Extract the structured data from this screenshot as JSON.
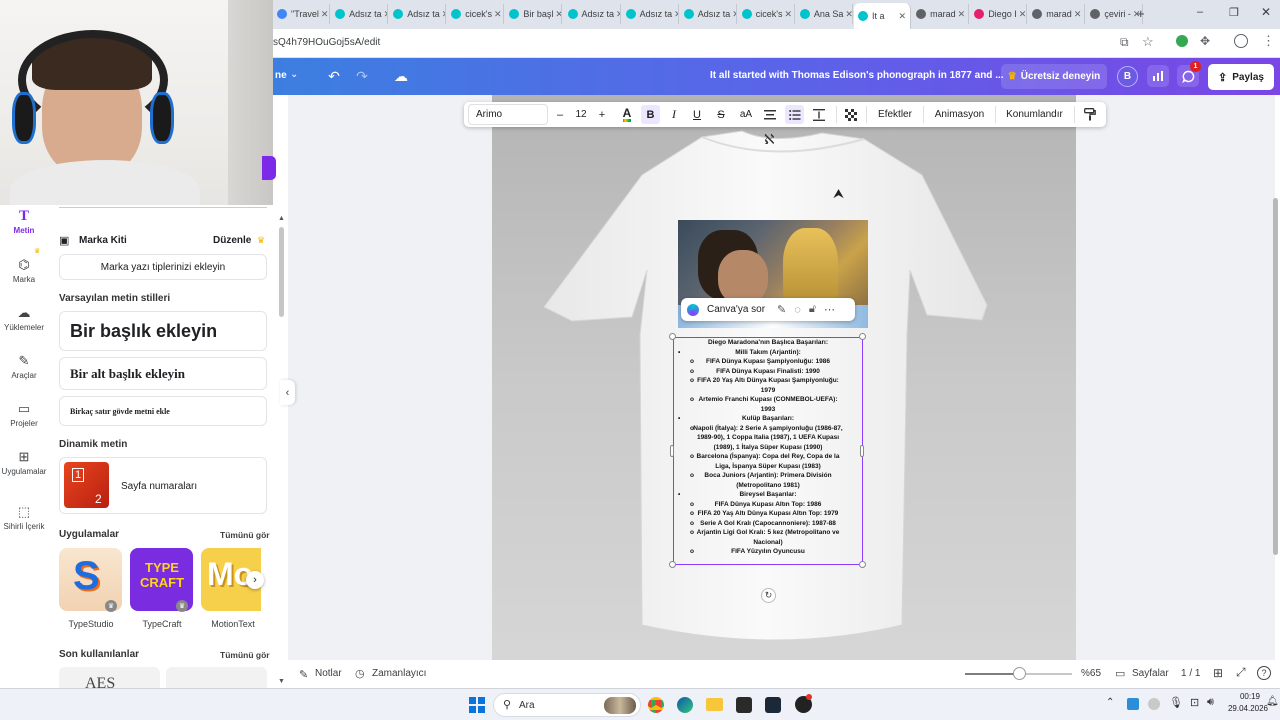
{
  "browser": {
    "tabs": [
      {
        "label": "\"Travel",
        "color": "#4285f4"
      },
      {
        "label": "Adsız ta",
        "color": "#00c4cc"
      },
      {
        "label": "Adsız ta",
        "color": "#00c4cc"
      },
      {
        "label": "cicek's",
        "color": "#00c4cc"
      },
      {
        "label": "Bir başl",
        "color": "#00c4cc"
      },
      {
        "label": "Adsız ta",
        "color": "#00c4cc"
      },
      {
        "label": "Adsız ta",
        "color": "#00c4cc"
      },
      {
        "label": "Adsız ta",
        "color": "#00c4cc"
      },
      {
        "label": "cicek's",
        "color": "#00c4cc"
      },
      {
        "label": "Ana Sa",
        "color": "#00c4cc"
      },
      {
        "label": "It a",
        "color": "#00c4cc"
      },
      {
        "label": "marad",
        "color": "#5f6368"
      },
      {
        "label": "Diego I",
        "color": "#e61e6e"
      },
      {
        "label": "marad",
        "color": "#5f6368"
      },
      {
        "label": "çeviri -",
        "color": "#5f6368"
      }
    ],
    "active_tab_index": 10,
    "new_tab": "+",
    "url": "sQ4h79HOuGoj5sA/edit"
  },
  "canva_top": {
    "file_menu_label": "ne",
    "doc_title": "It all started with Thomas Edison's phonograph in 1877 and ...",
    "trial_label": "Ücretsiz deneyin",
    "avatar_initial": "B",
    "comment_badge": "1",
    "share_label": "Paylaş"
  },
  "rail": [
    {
      "label": "Metin",
      "icon": "text-icon"
    },
    {
      "label": "Marka",
      "icon": "brand-icon"
    },
    {
      "label": "Yüklemeler",
      "icon": "upload-cloud-icon"
    },
    {
      "label": "Araçlar",
      "icon": "draw-tools-icon"
    },
    {
      "label": "Projeler",
      "icon": "folder-icon"
    },
    {
      "label": "Uygulamalar",
      "icon": "apps-icon"
    },
    {
      "label": "Sihirli İçerik",
      "icon": "magic-media-icon"
    }
  ],
  "panel": {
    "brand_kit_label": "Marka Kiti",
    "brand_kit_edit": "Düzenle",
    "add_brand_fonts": "Marka yazı tiplerinizi ekleyin",
    "default_styles_title": "Varsayılan metin stilleri",
    "heading": "Bir başlık ekleyin",
    "subheading": "Bir alt başlık ekleyin",
    "body": "Birkaç satır gövde metni ekle",
    "dynamic_title": "Dinamik metin",
    "page_numbers": "Sayfa numaraları",
    "page_numbers_thumb_a": "1",
    "page_numbers_thumb_b": "2",
    "apps_title": "Uygulamalar",
    "apps_see_all": "Tümünü gör",
    "apps": [
      {
        "name": "TypeStudio",
        "thumb": "S"
      },
      {
        "name": "TypeCraft",
        "thumb": "TYPE CRAFT"
      },
      {
        "name": "MotionText",
        "thumb": "Mo"
      }
    ],
    "recent_title": "Son kullanılanlar",
    "recent_see_all": "Tümünü gör",
    "recent_thumb_text": "AES"
  },
  "toolbar": {
    "font": "Arimo",
    "size_minus": "–",
    "font_size": "12",
    "size_plus": "+",
    "bold": "B",
    "italic": "I",
    "underline": "U",
    "strike": "S",
    "case": "aA",
    "effects": "Efektler",
    "animate": "Animasyon",
    "position": "Konumlandır"
  },
  "canvas": {
    "logo_text": "ℵ",
    "ask_canva": "Canva'ya sor",
    "text_lines": [
      {
        "text": "Diego Maradona'nın Başlıca Başarıları:",
        "bullet": ""
      },
      {
        "text": "Milli Takım (Arjantin):",
        "bullet": "•"
      },
      {
        "text": "FIFA Dünya Kupası Şampiyonluğu: 1986",
        "bullet": "o"
      },
      {
        "text": "FIFA Dünya Kupası Finalisti: 1990",
        "bullet": "o"
      },
      {
        "text": "FIFA 20 Yaş Altı Dünya Kupası Şampiyonluğu:",
        "bullet": "o"
      },
      {
        "text": "1979",
        "bullet": ""
      },
      {
        "text": "Artemio Franchi Kupası (CONMEBOL-UEFA):",
        "bullet": "o"
      },
      {
        "text": "1993",
        "bullet": ""
      },
      {
        "text": "Kulüp Başarıları:",
        "bullet": "•"
      },
      {
        "text": "Napoli (İtalya): 2 Serie A şampiyonluğu (1986-87,",
        "bullet": "o"
      },
      {
        "text": "1989-90), 1 Coppa Italia (1987), 1 UEFA Kupası",
        "bullet": ""
      },
      {
        "text": "(1989), 1 İtalya Süper Kupası (1990)",
        "bullet": ""
      },
      {
        "text": "Barcelona (İspanya): Copa del Rey, Copa de la",
        "bullet": "o"
      },
      {
        "text": "Liga, İspanya Süper Kupası (1983)",
        "bullet": ""
      },
      {
        "text": "Boca Juniors (Arjantin): Primera División",
        "bullet": "o"
      },
      {
        "text": "(Metropolitano 1981)",
        "bullet": ""
      },
      {
        "text": "Bireysel Başarılar:",
        "bullet": "•"
      },
      {
        "text": "FIFA Dünya Kupası Altın Top: 1986",
        "bullet": "o"
      },
      {
        "text": "FIFA 20 Yaş Altı Dünya Kupası Altın Top: 1979",
        "bullet": "o"
      },
      {
        "text": "Serie A Gol Kralı (Capocannoniere): 1987-88",
        "bullet": "o"
      },
      {
        "text": "Arjantin Ligi Gol Kralı: 5 kez (Metropolitano ve",
        "bullet": "o"
      },
      {
        "text": "Nacional)",
        "bullet": ""
      },
      {
        "text": "FIFA Yüzyılın Oyuncusu",
        "bullet": "o"
      }
    ]
  },
  "bottom": {
    "notes": "Notlar",
    "timer": "Zamanlayıcı",
    "zoom": "%65",
    "zoom_fraction": 0.5,
    "pages_label": "Sayfalar",
    "page_count": "1 / 1"
  },
  "taskbar": {
    "search": "Ara",
    "time": "00:19",
    "date": "29.04.2026"
  },
  "colors": {
    "accent_purple": "#8b3dff",
    "canva_gradient_start": "#3c7fe0",
    "canva_gradient_end": "#7a46e6",
    "crown_gold": "#f5b400"
  }
}
